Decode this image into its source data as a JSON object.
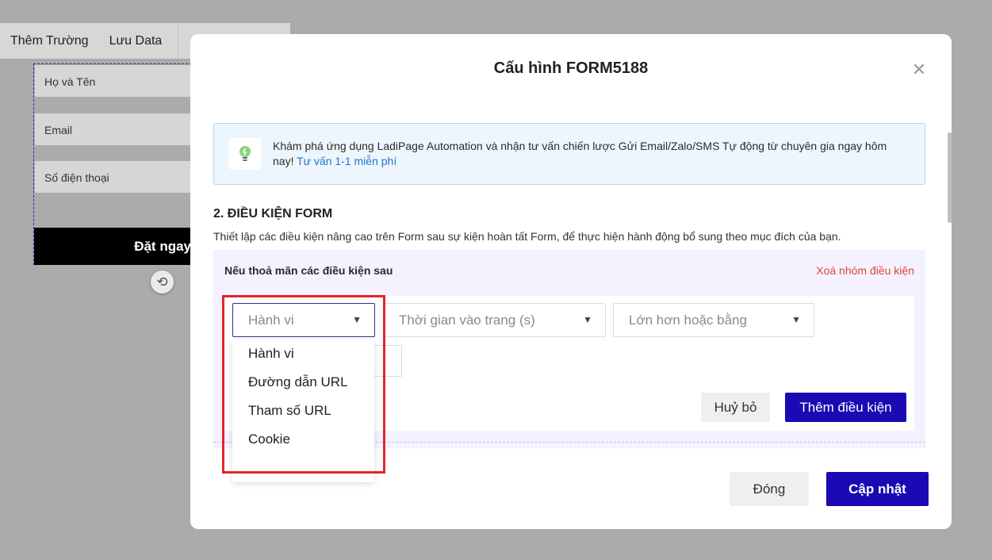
{
  "toolbar": {
    "add_field": "Thêm Trường",
    "save_data": "Lưu Data"
  },
  "form_preview": {
    "fields": [
      "Họ và Tên",
      "Email",
      "Số điện thoại"
    ],
    "submit": "Đặt ngay"
  },
  "modal": {
    "title": "Cấu hình FORM5188",
    "banner": {
      "text": "Khám phá ứng dụng LadiPage Automation và nhận tư vấn chiến lược Gửi Email/Zalo/SMS Tự động từ chuyên gia ngay hôm nay!",
      "link": "Tư vấn 1-1 miễn phí"
    },
    "section_title": "2. ĐIỀU KIỆN FORM",
    "section_desc": "Thiết lập các điều kiện nâng cao trên Form sau sự kiện hoàn tất Form, để thực hiện hành động bổ sung theo mục đích của bạn.",
    "group": {
      "label": "Nếu thoả mãn các điều kiện sau",
      "delete": "Xoá nhóm điều kiện",
      "selects": {
        "type": "Hành vi",
        "field": "Thời gian vào trang (s)",
        "operator": "Lớn hơn hoặc bằng"
      },
      "dropdown_options": [
        "Hành vi",
        "Đường dẫn URL",
        "Tham số URL",
        "Cookie"
      ],
      "cancel": "Huỷ bỏ",
      "add_condition": "Thêm điều kiện"
    },
    "footer": {
      "close": "Đóng",
      "update": "Cập nhật"
    }
  },
  "colors": {
    "primary": "#1b0ab3",
    "danger": "#e0413c",
    "link": "#1f73d1",
    "highlight": "#e8232a"
  }
}
